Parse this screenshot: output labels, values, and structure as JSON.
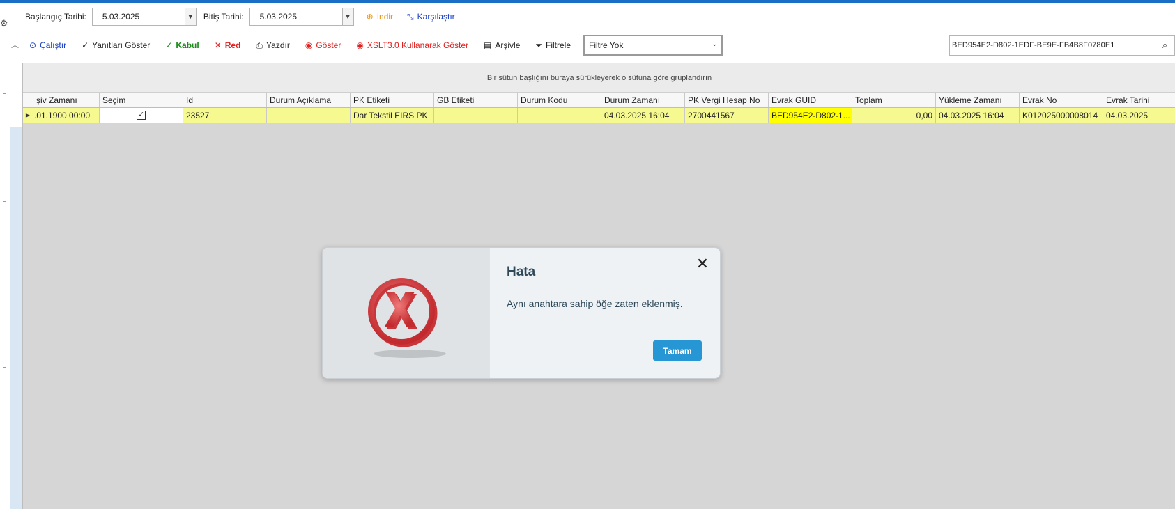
{
  "filters": {
    "start_label": "Başlangıç Tarihi:",
    "start_value": "5.03.2025",
    "end_label": "Bitiş Tarihi:",
    "end_value": "5.03.2025",
    "download_label": "İndir",
    "compare_label": "Karşılaştır"
  },
  "toolbar": {
    "run_label": "Çalıştır",
    "responses_label": "Yanıtları Göster",
    "accept_label": "Kabul",
    "reject_label": "Red",
    "print_label": "Yazdır",
    "show_label": "Göster",
    "xslt_label": "XSLT3.0 Kullanarak Göster",
    "archive_label": "Arşivle",
    "filter_label": "Filtrele",
    "filter_select_value": "Filtre Yok"
  },
  "search": {
    "value": "BED954E2-D802-1EDF-BE9E-FB4B8F0780E1"
  },
  "grid": {
    "group_hint": "Bir sütun başlığını buraya sürükleyerek o sütuna göre gruplandırın",
    "columns": [
      "şiv Zamanı",
      "Seçim",
      "Id",
      "Durum Açıklama",
      "PK Etiketi",
      "GB Etiketi",
      "Durum Kodu",
      "Durum Zamanı",
      "PK Vergi Hesap No",
      "Evrak GUID",
      "Toplam",
      "Yükleme Zamanı",
      "Evrak No",
      "Evrak Tarihi"
    ],
    "rows": [
      {
        "archive_time": ".01.1900 00:00",
        "selected": true,
        "id": "23527",
        "status_desc": "",
        "pk_label": "Dar Tekstil EIRS PK",
        "gb_label": "",
        "status_code": "",
        "status_time": "04.03.2025 16:04",
        "pk_tax_no": "2700441567",
        "doc_guid": "BED954E2-D802-1...",
        "total": "0,00",
        "upload_time": "04.03.2025 16:04",
        "doc_no": "K012025000008014",
        "doc_date": "04.03.2025"
      }
    ]
  },
  "dialog": {
    "title": "Hata",
    "message": "Aynı anahtara sahip öğe zaten eklenmiş.",
    "ok_label": "Tamam"
  },
  "colors": {
    "accent": "#1a6ec4",
    "row_highlight": "#f6f98f",
    "guid_highlight": "#ffff00",
    "ok_button": "#2796d4",
    "error_red": "#e0474c"
  }
}
